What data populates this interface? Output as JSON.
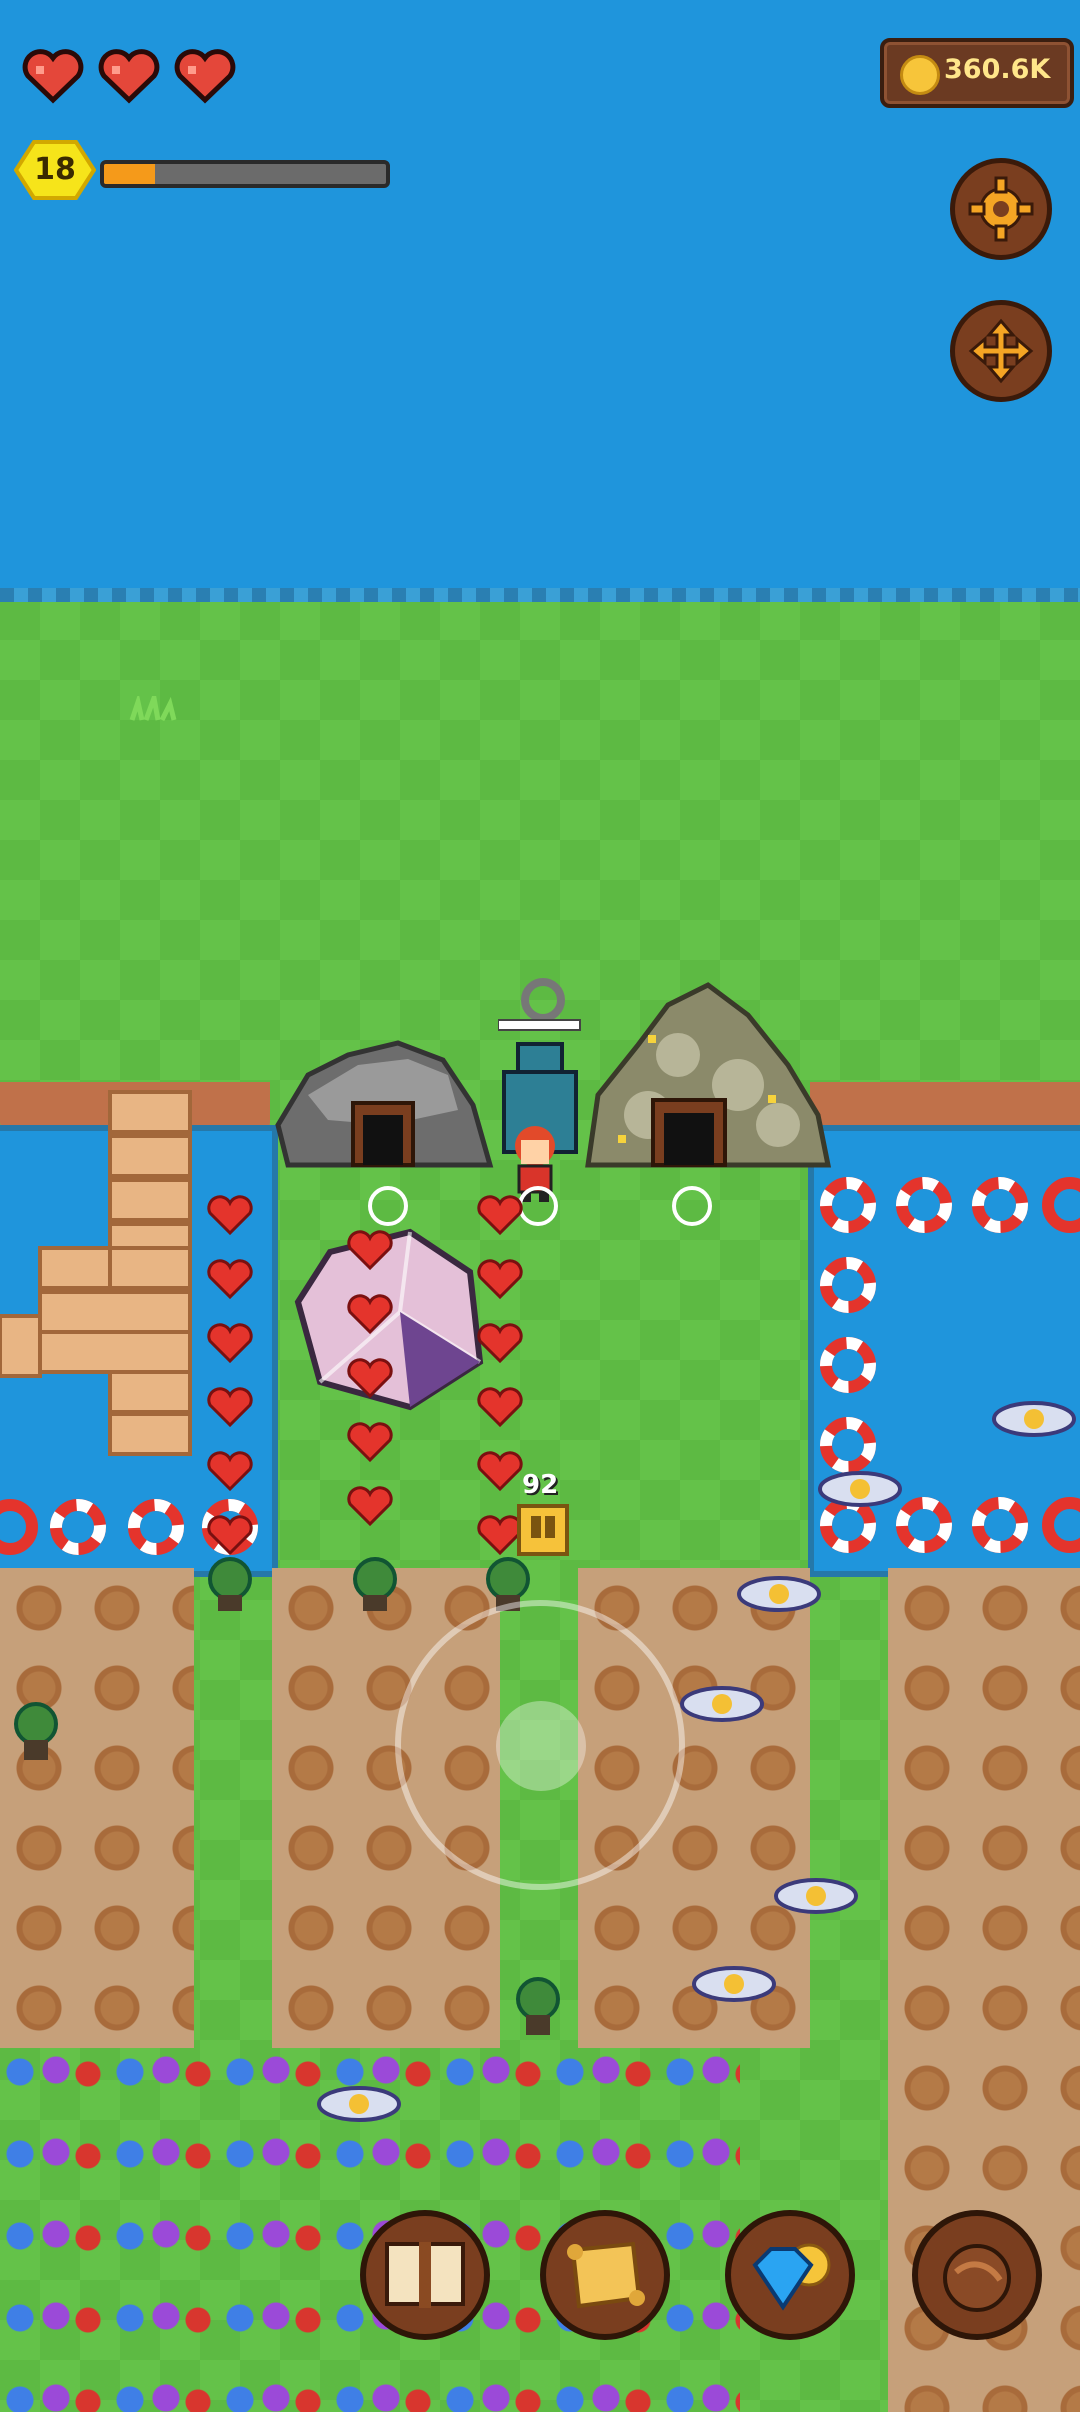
{
  "hud": {
    "hearts": 3,
    "level": "18",
    "xp_progress": 0.18,
    "coins": "360.6K",
    "settings_icon": "gear-icon",
    "move_icon": "move-arrows-icon"
  },
  "world": {
    "damage_number": "92"
  },
  "bottom_bar": {
    "items": [
      {
        "name": "book",
        "icon": "book-icon"
      },
      {
        "name": "map",
        "icon": "scroll-map-icon"
      },
      {
        "name": "shop",
        "icon": "gem-coin-icon"
      },
      {
        "name": "bag",
        "icon": "leather-bag-icon"
      }
    ]
  },
  "colors": {
    "water": "#1f95dc",
    "grass": "#5dba43",
    "soil": "#c6a07a",
    "button_bg": "#7a3e1f",
    "coin": "#f7c53a"
  }
}
